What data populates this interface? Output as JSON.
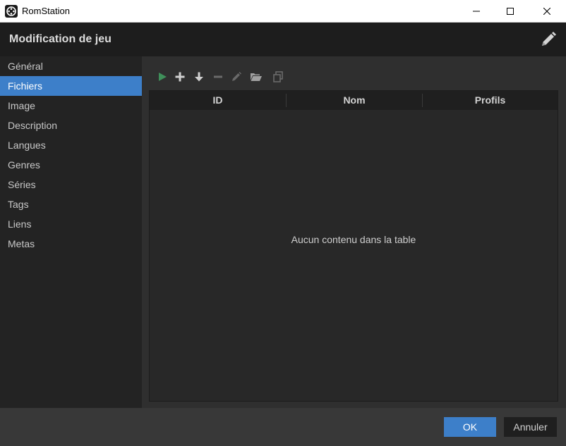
{
  "window": {
    "title": "RomStation"
  },
  "header": {
    "title": "Modification de jeu",
    "edit_icon": "pencil-icon"
  },
  "sidebar": {
    "items": [
      {
        "label": "Général"
      },
      {
        "label": "Fichiers",
        "active": true
      },
      {
        "label": "Image"
      },
      {
        "label": "Description"
      },
      {
        "label": "Langues"
      },
      {
        "label": "Genres"
      },
      {
        "label": "Séries"
      },
      {
        "label": "Tags"
      },
      {
        "label": "Liens"
      },
      {
        "label": "Metas"
      }
    ]
  },
  "toolbar": {
    "icons": [
      "play-icon",
      "plus-icon",
      "arrow-down-icon",
      "minus-icon",
      "pencil-icon",
      "folder-open-icon",
      "copy-icon"
    ]
  },
  "table": {
    "columns": [
      "ID",
      "Nom",
      "Profils"
    ],
    "empty_message": "Aucun contenu dans la table"
  },
  "footer": {
    "ok_label": "OK",
    "cancel_label": "Annuler"
  },
  "colors": {
    "accent": "#3d7fc9",
    "play_green": "#3f8f5a"
  }
}
